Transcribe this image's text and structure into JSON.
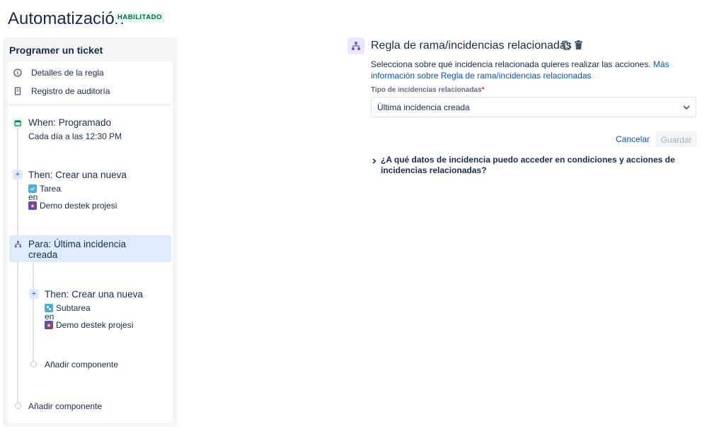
{
  "header": {
    "title": "Automatización",
    "badge": "HABILITADO"
  },
  "sidebar": {
    "title": "Programer un ticket",
    "menu": [
      {
        "label": "Detalles de la regla",
        "icon": "info-icon"
      },
      {
        "label": "Registro de auditoría",
        "icon": "audit-log-icon"
      }
    ],
    "steps": {
      "trigger": {
        "title": "When: Programado",
        "subtitle": "Cada día a las 12:30 PM",
        "icon": "calendar-icon"
      },
      "action1": {
        "title": "Then: Crear una nueva",
        "type": "Tarea",
        "connector": "en",
        "project": "Demo destek projesi",
        "icon": "plus-icon"
      },
      "branch": {
        "title_line1": "Para: Última incidencia",
        "title_line2": "creada",
        "icon": "branch-icon"
      },
      "action2": {
        "title": "Then: Crear una nueva",
        "type": "Subtarea",
        "connector": "en",
        "project": "Demo destek projesi",
        "icon": "plus-icon"
      },
      "add_inner": "Añadir componente",
      "add_outer": "Añadir componente"
    }
  },
  "main": {
    "title": "Regla de rama/incidencias relacionadas",
    "description": "Selecciona sobre qué incidencia relacionada quieres realizar las acciones.",
    "link": "Más información sobre Regla de rama/incidencias relacionadas",
    "field_label": "Tipo de incidencias relacionadas",
    "required_mark": "*",
    "select_value": "Última incidencia creada",
    "cancel_label": "Cancelar",
    "save_label": "Guardar",
    "faq": "¿A qué datos de incidencia puedo acceder en condiciones y acciones de incidencias relacionadas?"
  },
  "colors": {
    "accent": "#0052cc",
    "badge_bg": "#e3fcef",
    "badge_text": "#006644",
    "selected_bg": "#deebff",
    "branch_bg": "#eae6ff"
  }
}
